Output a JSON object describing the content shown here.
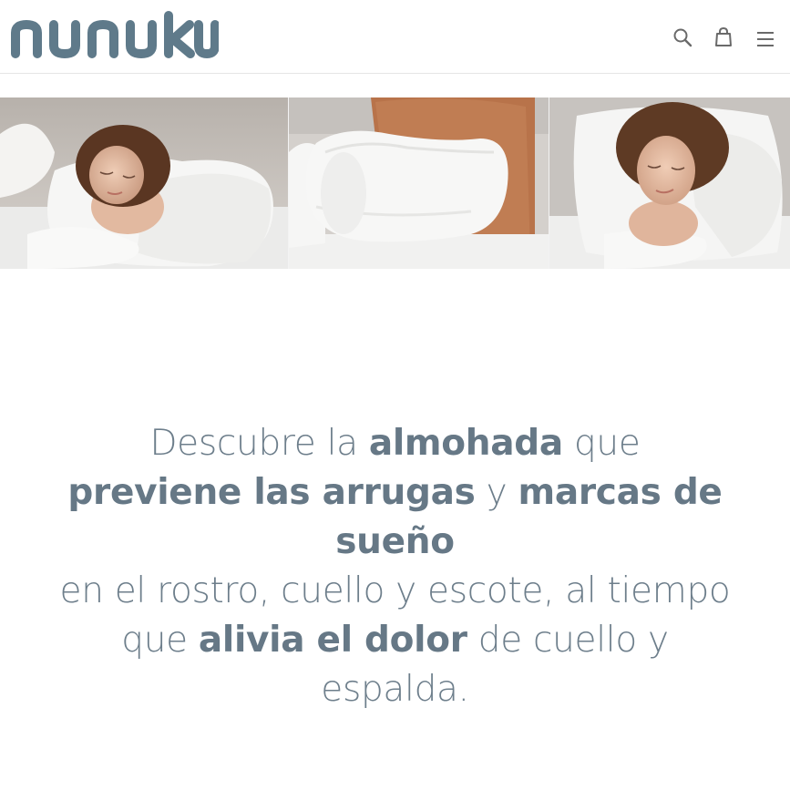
{
  "header": {
    "logo_text": "nunuku",
    "icons": [
      "search-icon",
      "cart-icon",
      "hamburger-menu-icon"
    ]
  },
  "hero": {
    "photos": [
      "woman-sleeping-on-pillow",
      "white-contour-pillow-on-bed",
      "woman-resting-on-pillow"
    ]
  },
  "intro": {
    "line1": {
      "part1": "Descubre la ",
      "bold1": "almohada",
      "part2": " que"
    },
    "line2": {
      "bold1": "previene las arrugas",
      "part1": " y ",
      "bold2": "marcas de"
    },
    "line3": {
      "bold1": "sueño"
    },
    "line4": {
      "part1": "en el rostro, cuello y escote, al tiempo"
    },
    "line5": {
      "part1": "que ",
      "bold1": "alivia el dolor",
      "part2": " de cuello y"
    },
    "line6": {
      "part1": "espalda."
    }
  },
  "colors": {
    "brand": "#5f7a8a",
    "text": "#6d7e8b",
    "border": "#e6e6e6"
  }
}
